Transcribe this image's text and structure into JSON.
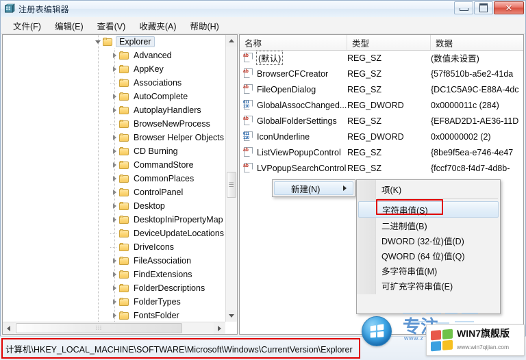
{
  "window": {
    "title": "注册表编辑器",
    "icon": "registry-editor-icon",
    "buttons": {
      "minimize": "minimize-button",
      "maximize": "maximize-button",
      "close": "✕"
    }
  },
  "menubar": {
    "items": [
      {
        "label": "文件(F)"
      },
      {
        "label": "编辑(E)"
      },
      {
        "label": "查看(V)"
      },
      {
        "label": "收藏夹(A)"
      },
      {
        "label": "帮助(H)"
      }
    ]
  },
  "tree": {
    "root": {
      "label": "Explorer",
      "selected": true,
      "expanded": true
    },
    "items": [
      {
        "label": "Advanced",
        "expandable": true
      },
      {
        "label": "AppKey",
        "expandable": true
      },
      {
        "label": "Associations",
        "expandable": false
      },
      {
        "label": "AutoComplete",
        "expandable": true
      },
      {
        "label": "AutoplayHandlers",
        "expandable": true
      },
      {
        "label": "BrowseNewProcess",
        "expandable": false
      },
      {
        "label": "Browser Helper Objects",
        "expandable": true
      },
      {
        "label": "CD Burning",
        "expandable": true
      },
      {
        "label": "CommandStore",
        "expandable": true
      },
      {
        "label": "CommonPlaces",
        "expandable": true
      },
      {
        "label": "ControlPanel",
        "expandable": true
      },
      {
        "label": "Desktop",
        "expandable": true
      },
      {
        "label": "DesktopIniPropertyMap",
        "expandable": true
      },
      {
        "label": "DeviceUpdateLocations",
        "expandable": false
      },
      {
        "label": "DriveIcons",
        "expandable": false
      },
      {
        "label": "FileAssociation",
        "expandable": true
      },
      {
        "label": "FindExtensions",
        "expandable": true
      },
      {
        "label": "FolderDescriptions",
        "expandable": true
      },
      {
        "label": "FolderTypes",
        "expandable": true
      },
      {
        "label": "FontsFolder",
        "expandable": true
      }
    ]
  },
  "list": {
    "columns": [
      {
        "label": "名称"
      },
      {
        "label": "类型"
      },
      {
        "label": "数据"
      }
    ],
    "rows": [
      {
        "name": "(默认)",
        "type": "REG_SZ",
        "data": "(数值未设置)",
        "icon": "string-value-icon",
        "dotted": true
      },
      {
        "name": "BrowserCFCreator",
        "type": "REG_SZ",
        "data": "{57f8510b-a5e2-41da",
        "icon": "string-value-icon",
        "dotted": false
      },
      {
        "name": "FileOpenDialog",
        "type": "REG_SZ",
        "data": "{DC1C5A9C-E88A-4dc",
        "icon": "string-value-icon",
        "dotted": false
      },
      {
        "name": "GlobalAssocChanged...",
        "type": "REG_DWORD",
        "data": "0x0000011c (284)",
        "icon": "dword-value-icon",
        "dotted": false
      },
      {
        "name": "GlobalFolderSettings",
        "type": "REG_SZ",
        "data": "{EF8AD2D1-AE36-11D",
        "icon": "string-value-icon",
        "dotted": false
      },
      {
        "name": "IconUnderline",
        "type": "REG_DWORD",
        "data": "0x00000002 (2)",
        "icon": "dword-value-icon",
        "dotted": false
      },
      {
        "name": "ListViewPopupControl",
        "type": "REG_SZ",
        "data": "{8be9f5ea-e746-4e47",
        "icon": "string-value-icon",
        "dotted": false
      },
      {
        "name": "LVPopupSearchControl",
        "type": "REG_SZ",
        "data": "{fccf70c8-f4d7-4d8b-",
        "icon": "string-value-icon",
        "dotted": false
      }
    ]
  },
  "context_menu": {
    "parent": {
      "label": "新建(N)",
      "highlighted": true,
      "has_submenu": true
    },
    "submenu": [
      {
        "label": "项(K)",
        "highlighted": false,
        "boxed": false
      },
      {
        "label": "字符串值(S)",
        "highlighted": true,
        "boxed": true
      },
      {
        "label": "二进制值(B)",
        "highlighted": false,
        "boxed": false
      },
      {
        "label": "DWORD (32-位)值(D)",
        "highlighted": false,
        "boxed": false
      },
      {
        "label": "QWORD (64 位)值(Q)",
        "highlighted": false,
        "boxed": false
      },
      {
        "label": "多字符串值(M)",
        "highlighted": false,
        "boxed": false
      },
      {
        "label": "可扩充字符串值(E)",
        "highlighted": false,
        "boxed": false
      }
    ]
  },
  "statusbar": {
    "path": "计算机\\HKEY_LOCAL_MACHINE\\SOFTWARE\\Microsoft\\Windows\\CurrentVersion\\Explorer"
  },
  "watermark": {
    "brand": "WIN7旗舰版",
    "url": "www.win7qijian.com",
    "brush_text": "专注",
    "brush_url": "www.z"
  },
  "colors": {
    "accent_red": "#e00000",
    "folder": "#f6c95e",
    "string_icon": "#c0392b",
    "dword_icon": "#1c5fa8",
    "close_button": "#d8503f"
  }
}
